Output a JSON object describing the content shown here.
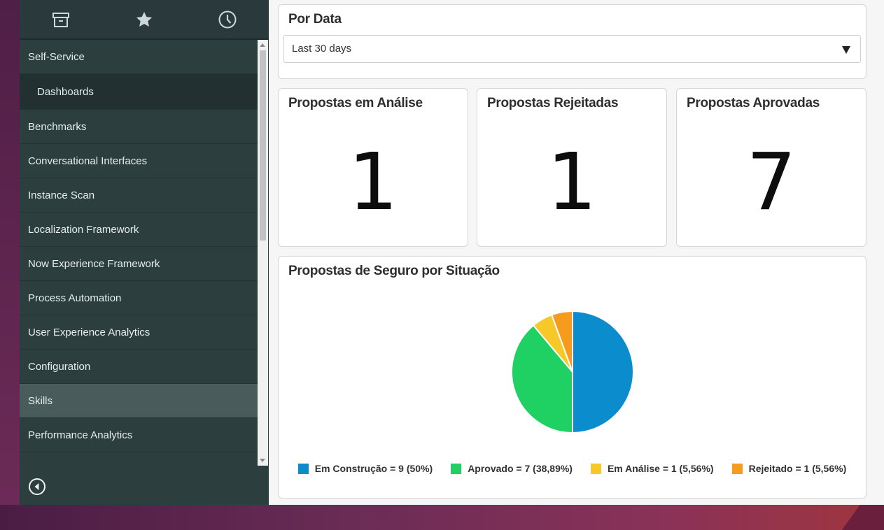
{
  "sidebar": {
    "tabs": [
      {
        "name": "all-applications",
        "icon": "archive-box-icon"
      },
      {
        "name": "favorites",
        "icon": "star-icon"
      },
      {
        "name": "history",
        "icon": "clock-icon"
      }
    ],
    "items": [
      {
        "label": "Self-Service",
        "type": "section"
      },
      {
        "label": "Dashboards",
        "type": "sub"
      },
      {
        "label": "Benchmarks",
        "type": "section"
      },
      {
        "label": "Conversational Interfaces",
        "type": "section"
      },
      {
        "label": "Instance Scan",
        "type": "section"
      },
      {
        "label": "Localization Framework",
        "type": "section"
      },
      {
        "label": "Now Experience Framework",
        "type": "section"
      },
      {
        "label": "Process Automation",
        "type": "section"
      },
      {
        "label": "User Experience Analytics",
        "type": "section"
      },
      {
        "label": "Configuration",
        "type": "section"
      },
      {
        "label": "Skills",
        "type": "section",
        "active": true
      },
      {
        "label": "Performance Analytics",
        "type": "section"
      }
    ],
    "collapse_icon": "collapse-left-circle-icon"
  },
  "filter": {
    "title": "Por Data",
    "selected": "Last 30 days"
  },
  "kpis": [
    {
      "title": "Propostas em Análise",
      "value": "1"
    },
    {
      "title": "Propostas Rejeitadas",
      "value": "1"
    },
    {
      "title": "Propostas Aprovadas",
      "value": "7"
    }
  ],
  "pie_card": {
    "title": "Propostas de Seguro por Situação"
  },
  "chart_data": {
    "type": "pie",
    "slices": [
      {
        "label": "Em Construção = 9 (50%)",
        "value": 9,
        "color": "#0b8ccd"
      },
      {
        "label": "Aprovado = 7 (38,89%)",
        "value": 7,
        "color": "#1fd162"
      },
      {
        "label": "Em Análise = 1 (5,56%)",
        "value": 1,
        "color": "#f7c928"
      },
      {
        "label": "Rejeitado = 1 (5,56%)",
        "value": 1,
        "color": "#f79b1c"
      }
    ],
    "legend_position": "bottom"
  },
  "colors": {
    "sidebar_bg": "#2d3e3f",
    "sidebar_active": "#4a5b5c",
    "desktop_bg": "#6b2a57"
  }
}
